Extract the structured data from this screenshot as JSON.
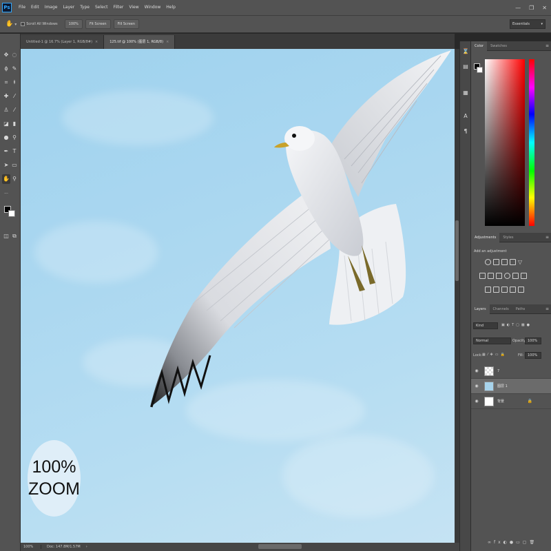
{
  "menubar": {
    "logo": "Ps",
    "items": [
      "File",
      "Edit",
      "Image",
      "Layer",
      "Type",
      "Select",
      "Filter",
      "View",
      "Window",
      "Help"
    ]
  },
  "options": {
    "scroll_all_label": "Scroll All Windows",
    "zoom_label": "100%",
    "fit_screen_label": "Fit Screen",
    "fill_screen_label": "Fill Screen",
    "workspace": "Essentials"
  },
  "tabs": [
    {
      "label": "Untitled-1 @ 16.7% (Layer 1, RGB/8#)",
      "active": false
    },
    {
      "label": "125.tif @ 100% (图层 1, RGB/8)",
      "active": true
    }
  ],
  "canvas": {
    "zoom_badge_line1": "100%",
    "zoom_badge_line2": "ZOOM"
  },
  "status": {
    "zoom": "100%",
    "doc": "Doc: 147.8M/1.57M",
    "arrow": "›"
  },
  "color_panel": {
    "tabs": [
      "Color",
      "Swatches"
    ],
    "foreground": "#000000",
    "background": "#ffffff"
  },
  "adjustments_panel": {
    "tabs": [
      "Adjustments",
      "Styles"
    ],
    "title": "Add an adjustment"
  },
  "layers_panel": {
    "tabs": [
      "Layers",
      "Channels",
      "Paths"
    ],
    "kind_filter": "Kind",
    "blend_mode": "Normal",
    "opacity_label": "Opacity:",
    "opacity_value": "100%",
    "lock_label": "Lock:",
    "fill_label": "Fill:",
    "fill_value": "100%",
    "layers": [
      {
        "name": "7",
        "selected": false
      },
      {
        "name": "图层 1",
        "selected": true
      },
      {
        "name": "背景",
        "selected": false
      }
    ]
  }
}
